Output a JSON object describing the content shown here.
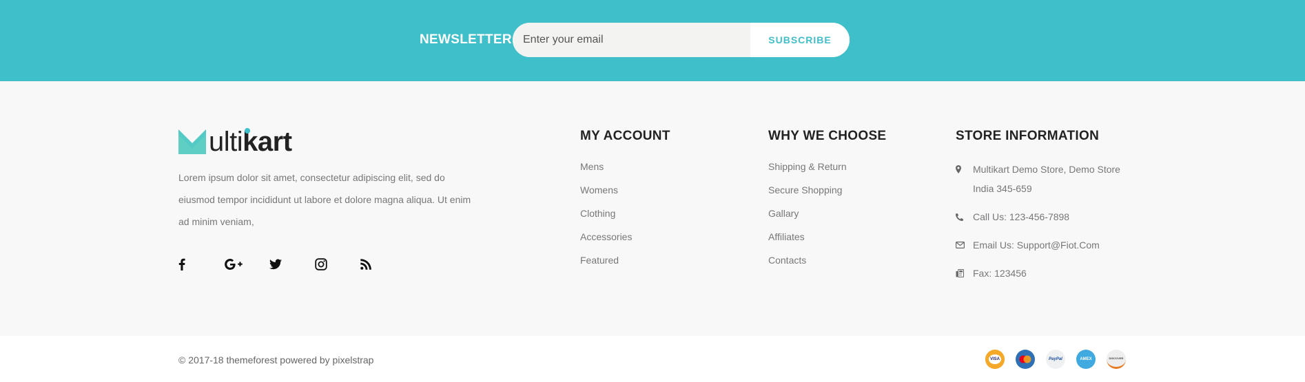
{
  "newsletter": {
    "title": "NEWSLETTER",
    "email_placeholder": "Enter your email",
    "subscribe_label": "SUBSCRIBE"
  },
  "brand": {
    "logo_text_light": "ulti",
    "logo_text_bold": "kart",
    "accent_color": "#3fbfc9",
    "about": "Lorem ipsum dolor sit amet, consectetur adipiscing elit, sed do eiusmod tempor incididunt ut labore et dolore magna aliqua. Ut enim ad minim veniam,"
  },
  "social": [
    "facebook-icon",
    "google-plus-icon",
    "twitter-icon",
    "instagram-icon",
    "rss-icon"
  ],
  "my_account": {
    "title": "MY ACCOUNT",
    "items": [
      "Mens",
      "Womens",
      "Clothing",
      "Accessories",
      "Featured"
    ]
  },
  "why_we_choose": {
    "title": "WHY WE CHOOSE",
    "items": [
      "Shipping & Return",
      "Secure Shopping",
      "Gallary",
      "Affiliates",
      "Contacts"
    ]
  },
  "store_information": {
    "title": "STORE INFORMATION",
    "address": "Multikart Demo Store, Demo Store India 345-659",
    "phone": "Call Us: 123-456-7898",
    "email": "Email Us: Support@Fiot.Com",
    "fax": "Fax: 123456"
  },
  "bottom": {
    "copyright": "© 2017-18 themeforest powered by pixelstrap",
    "payments": [
      {
        "icon": "visa-icon",
        "text": "VISA"
      },
      {
        "icon": "mastercard-icon",
        "text": ""
      },
      {
        "icon": "paypal-icon",
        "text": "PayPal"
      },
      {
        "icon": "american-express-icon",
        "text": "AMEX"
      },
      {
        "icon": "discover-icon",
        "text": "DISCOVER"
      }
    ]
  }
}
